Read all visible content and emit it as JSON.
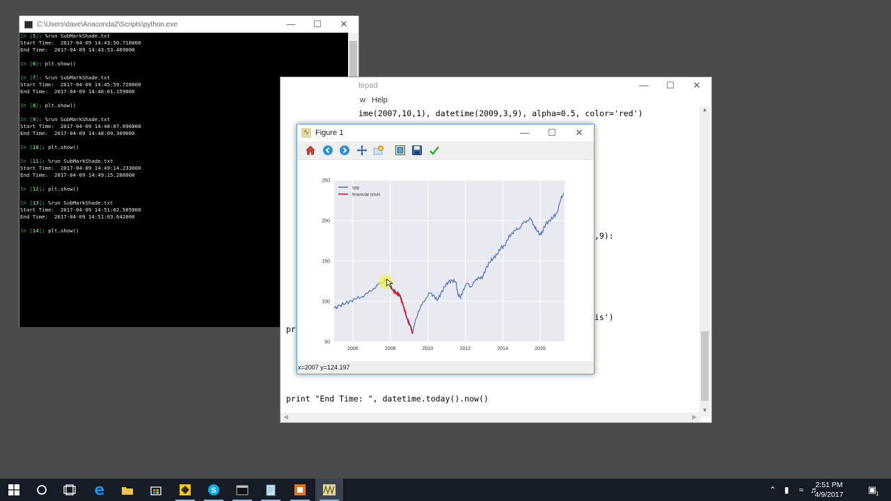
{
  "console": {
    "title": "C:\\Users\\dave\\Anaconda2\\Scripts\\python.exe",
    "lines": [
      {
        "kind": "in",
        "num": "5",
        "text": ": %run SubMarkShade.txt"
      },
      {
        "kind": "out",
        "text": "Start Time:  2017-04-09 14:43:50.718000"
      },
      {
        "kind": "out",
        "text": "End Time:  2017-04-09 14:43:53.469000"
      },
      {
        "kind": "gap"
      },
      {
        "kind": "in",
        "num": "6",
        "text": ": plt.show()"
      },
      {
        "kind": "gap"
      },
      {
        "kind": "in",
        "num": "7",
        "text": ": %run SubMarkShade.txt"
      },
      {
        "kind": "out",
        "text": "Start Time:  2017-04-09 14:45:59.728000"
      },
      {
        "kind": "out",
        "text": "End Time:  2017-04-09 14:46:01.159000"
      },
      {
        "kind": "gap"
      },
      {
        "kind": "in",
        "num": "8",
        "text": ": plt.show()"
      },
      {
        "kind": "gap"
      },
      {
        "kind": "in",
        "num": "9",
        "text": ": %run SubMarkShade.txt"
      },
      {
        "kind": "out",
        "text": "Start Time:  2017-04-09 14:48:07.696000"
      },
      {
        "kind": "out",
        "text": "End Time:  2017-04-09 14:48:09.309000"
      },
      {
        "kind": "gap"
      },
      {
        "kind": "in",
        "num": "10",
        "text": ": plt.show()"
      },
      {
        "kind": "gap"
      },
      {
        "kind": "in",
        "num": "11",
        "text": ": %run SubMarkShade.txt"
      },
      {
        "kind": "out",
        "text": "Start Time:  2017-04-09 14:49:14.233000"
      },
      {
        "kind": "out",
        "text": "End Time:  2017-04-09 14:49:15.288000"
      },
      {
        "kind": "gap"
      },
      {
        "kind": "in",
        "num": "12",
        "text": ": plt.show()"
      },
      {
        "kind": "gap"
      },
      {
        "kind": "in",
        "num": "13",
        "text": ": %run SubMarkShade.txt"
      },
      {
        "kind": "out",
        "text": "Start Time:  2017-04-09 14:51:02.505000"
      },
      {
        "kind": "out",
        "text": "End Time:  2017-04-09 14:51:03.642000"
      },
      {
        "kind": "gap"
      },
      {
        "kind": "in",
        "num": "14",
        "text": ": plt.show()"
      }
    ]
  },
  "notepad": {
    "title_partial": "tepad",
    "menu": [
      "w",
      "Help"
    ],
    "lines": [
      {
        "text": "ime(2007,10,1), datetime(2009,3,9), alpha=0.5, color='red')"
      },
      {
        "text": ",9):"
      },
      {
        "text": "is')"
      },
      {
        "text": "pr"
      },
      {
        "text": "print \"End Time: \", datetime.today().now()"
      }
    ]
  },
  "figure": {
    "title": "Figure 1",
    "status": "x=2007 y=124.197",
    "toolbar": [
      "home-icon",
      "back-icon",
      "forward-icon",
      "pan-icon",
      "zoom-icon",
      "subplots-icon",
      "save-icon",
      "edit-icon"
    ]
  },
  "chart_data": {
    "type": "line",
    "title": "",
    "xlabel": "",
    "ylabel": "",
    "xlim": [
      2005.0,
      2017.3
    ],
    "ylim": [
      50,
      250
    ],
    "xticks": [
      2006,
      2008,
      2010,
      2012,
      2014,
      2016
    ],
    "xtick_labels": [
      "2006",
      "2008",
      "2010",
      "2012",
      "2014",
      "2016"
    ],
    "yticks": [
      50,
      100,
      150,
      200,
      250
    ],
    "ytick_labels": [
      "50",
      "100",
      "150",
      "200",
      "250"
    ],
    "grid": true,
    "background": "#e9e9f1",
    "legend_position": "top-left",
    "series": [
      {
        "name": "spy",
        "color": "#4c72b0",
        "x": [
          2005.0,
          2005.3,
          2005.6,
          2005.9,
          2006.2,
          2006.5,
          2006.8,
          2007.1,
          2007.4,
          2007.6,
          2007.75,
          2007.9,
          2008.1,
          2008.3,
          2008.5,
          2008.7,
          2008.9,
          2009.1,
          2009.18,
          2009.3,
          2009.5,
          2009.7,
          2009.9,
          2010.1,
          2010.3,
          2010.5,
          2010.7,
          2010.9,
          2011.1,
          2011.3,
          2011.5,
          2011.6,
          2011.75,
          2011.9,
          2012.1,
          2012.3,
          2012.5,
          2012.7,
          2012.9,
          2013.1,
          2013.3,
          2013.5,
          2013.7,
          2013.9,
          2014.1,
          2014.3,
          2014.5,
          2014.7,
          2014.9,
          2015.1,
          2015.3,
          2015.5,
          2015.65,
          2015.8,
          2016.0,
          2016.1,
          2016.3,
          2016.5,
          2016.7,
          2016.9,
          2017.1,
          2017.25
        ],
        "values": [
          91,
          95,
          97,
          101,
          103,
          106,
          110,
          116,
          121,
          124,
          126,
          124,
          115,
          110,
          108,
          94,
          78,
          68,
          60,
          72,
          88,
          96,
          104,
          110,
          108,
          101,
          110,
          118,
          124,
          126,
          124,
          110,
          104,
          115,
          122,
          118,
          124,
          130,
          128,
          141,
          148,
          154,
          158,
          166,
          169,
          178,
          185,
          188,
          191,
          197,
          200,
          202,
          195,
          188,
          183,
          185,
          196,
          200,
          204,
          210,
          226,
          234
        ]
      },
      {
        "name": "financial crisis",
        "color": "#e0000f",
        "x": [
          2007.75,
          2007.9,
          2008.1,
          2008.3,
          2008.5,
          2008.7,
          2008.9,
          2009.1,
          2009.18
        ],
        "values": [
          126,
          124,
          115,
          110,
          108,
          94,
          78,
          68,
          60
        ]
      }
    ]
  },
  "taskbar": {
    "apps": [
      "windows-start-icon",
      "cortana-icon",
      "task-view-icon",
      "edge-icon",
      "file-explorer-icon",
      "store-icon",
      "app-yellow-icon",
      "skype-icon",
      "console-icon",
      "notepad-icon",
      "app-orange-icon",
      "matplotlib-icon"
    ],
    "time": "2:51 PM",
    "date": "4/9/2017",
    "notification_count": "1"
  }
}
